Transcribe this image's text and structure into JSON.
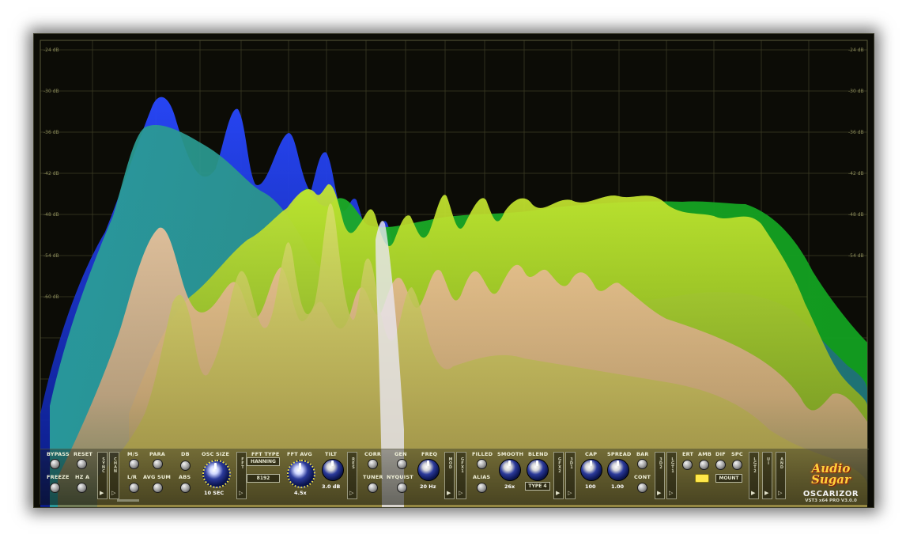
{
  "app": {
    "name": "OSCARIZOR",
    "version": "VST3 x64 PRO V3.0.0",
    "brand": "Audio Sugar"
  },
  "db_labels": [
    "-24 dB",
    "-30 dB",
    "-36 dB",
    "-42 dB",
    "-48 dB",
    "-54 dB",
    "-60 dB"
  ],
  "controls": {
    "bypass": "BYPASS",
    "reset": "RESET",
    "freeze": "FREEZE",
    "hz_a": "HZ A",
    "sync_tab": "SYNC",
    "chan_tab": "CHAN",
    "ms": "M/S",
    "lr": "L/R",
    "para": "PARA",
    "avg_sum": "AVG SUM",
    "db": "DB",
    "abs": "ABS",
    "osc_size_label": "OSC SIZE",
    "osc_size_value": "10 SEC",
    "fft_tab": "FFT",
    "fft_type_label": "FFT TYPE",
    "fft_type_value": "HANNING",
    "fft_size_value": "8192",
    "fft_avg_label": "FFT AVG",
    "fft_avg_value": "4.5x",
    "tilt_label": "TILT",
    "tilt_value": "3.0 dB",
    "res_tab": "RES",
    "corr": "CORR",
    "tuner": "TUNER",
    "gen": "GEN",
    "nyquist": "NYQUIST",
    "freq_label": "FREQ",
    "freq_value": "20 Hz",
    "mod_tab": "MOD",
    "gfx1_tab": "GFX1",
    "filled": "FILLED",
    "alias": "ALIAS",
    "smooth_label": "SMOOTH",
    "smooth_value": "26x",
    "blend_label": "BLEND",
    "blend_value": "TYPE 4",
    "gfx2_tab": "GFX2",
    "gfx3d1_tab": "3D1",
    "cap_label": "CAP",
    "cap_value": "100",
    "spread_label": "SPREAD",
    "spread_value": "1.00",
    "bar": "BAR",
    "cont": "CONT",
    "gfx3d2_tab": "3D2",
    "lgt1_tab": "LGT1",
    "ert": "ERT",
    "amb": "AMB",
    "dif": "DIF",
    "spc": "SPC",
    "mount": "MOUNT",
    "lgt2_tab": "LGT2",
    "ui_tab": "UI",
    "and_tab": "AND"
  },
  "colors": {
    "blue": "#1f3ee0",
    "teal": "#1f9e8a",
    "green": "#21b22a",
    "lime": "#b8e02a",
    "peach": "#e8b48a"
  }
}
